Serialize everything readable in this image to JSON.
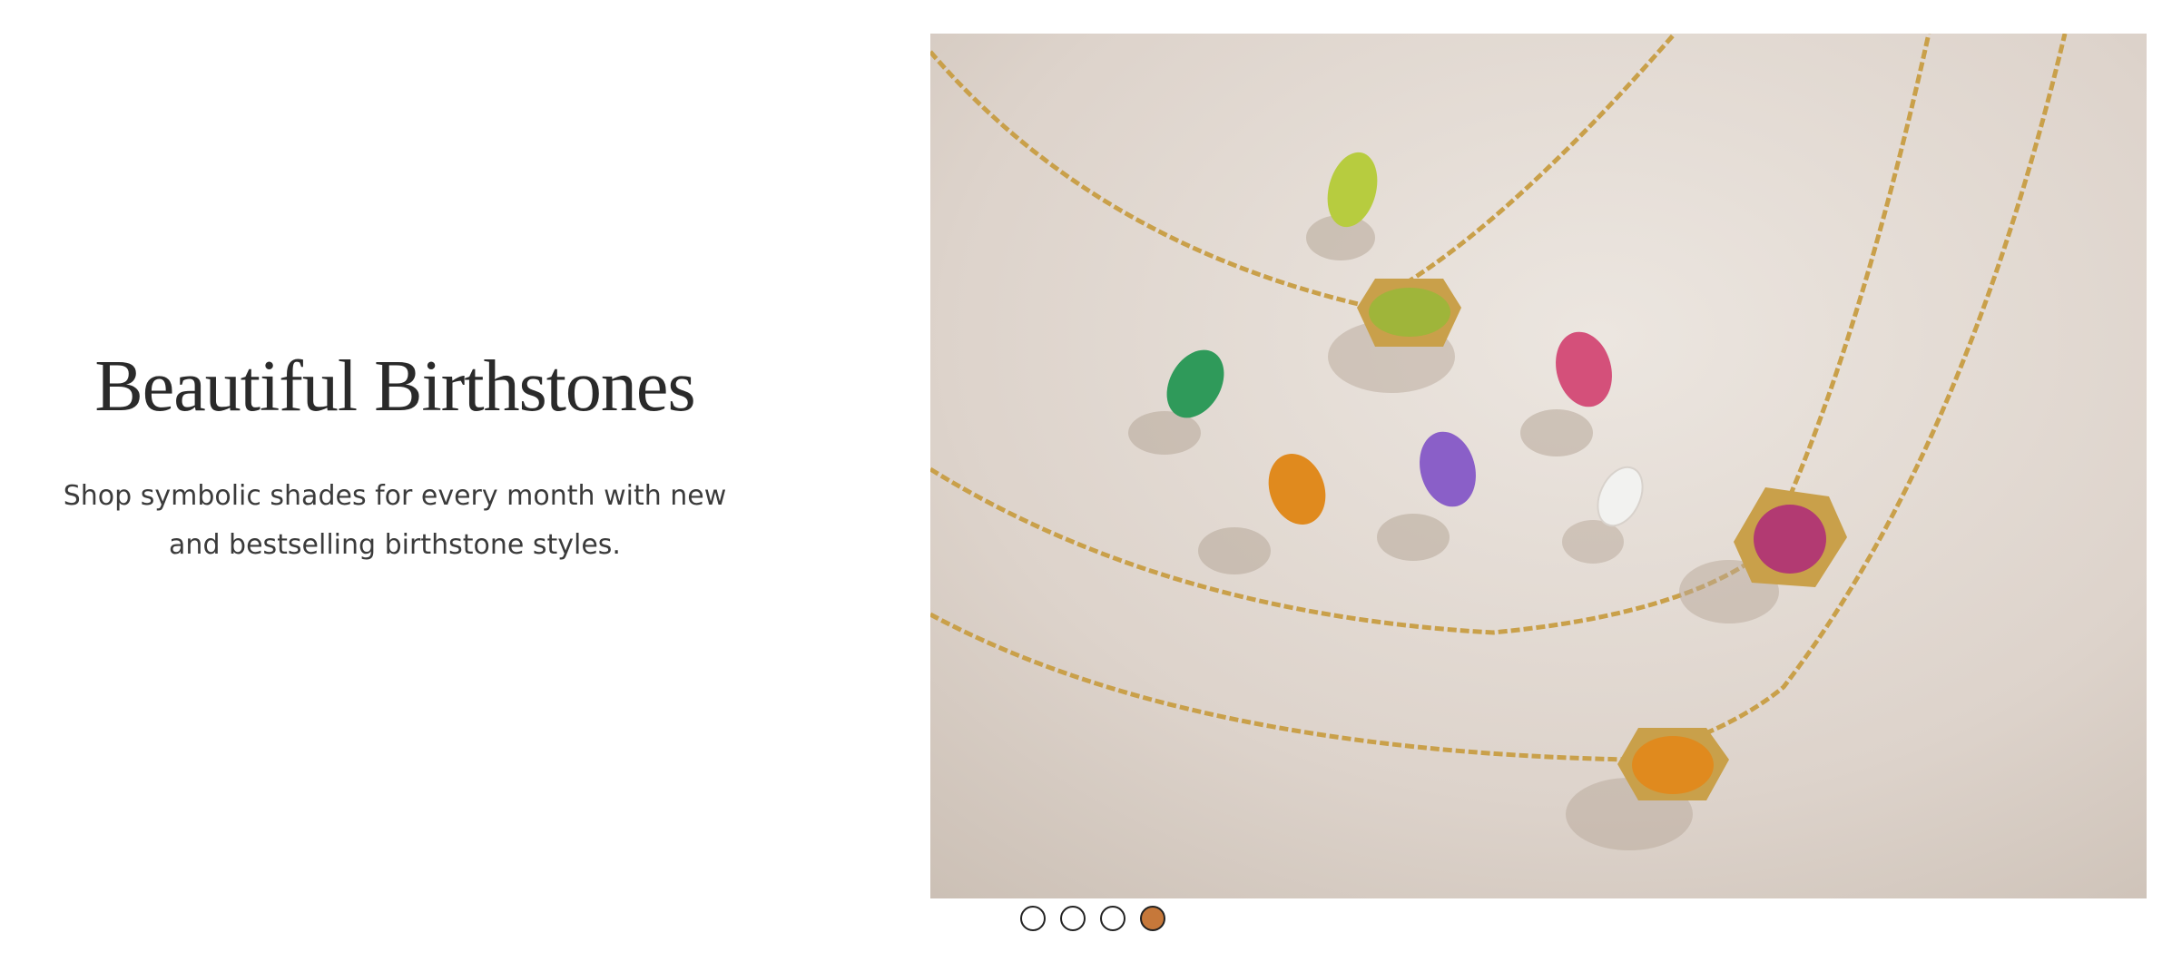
{
  "promo": {
    "title": "Beautiful Birthstones",
    "description": "Shop symbolic shades for every month with new and bestselling birthstone styles."
  },
  "hero_image": {
    "icon": "birthstone-necklaces-image",
    "colors": {
      "background": "#ddd3cb",
      "gold": "#c9a04a",
      "peridot": "#9fb53a",
      "emerald": "#2f9a5a",
      "citrine": "#e08a1e",
      "amethyst": "#8a5fc8",
      "tourmaline": "#d4507a",
      "diamond": "#f2f2f0"
    }
  },
  "carousel": {
    "slide_count": 4,
    "active_index": 3,
    "active_color": "#c6783a"
  }
}
